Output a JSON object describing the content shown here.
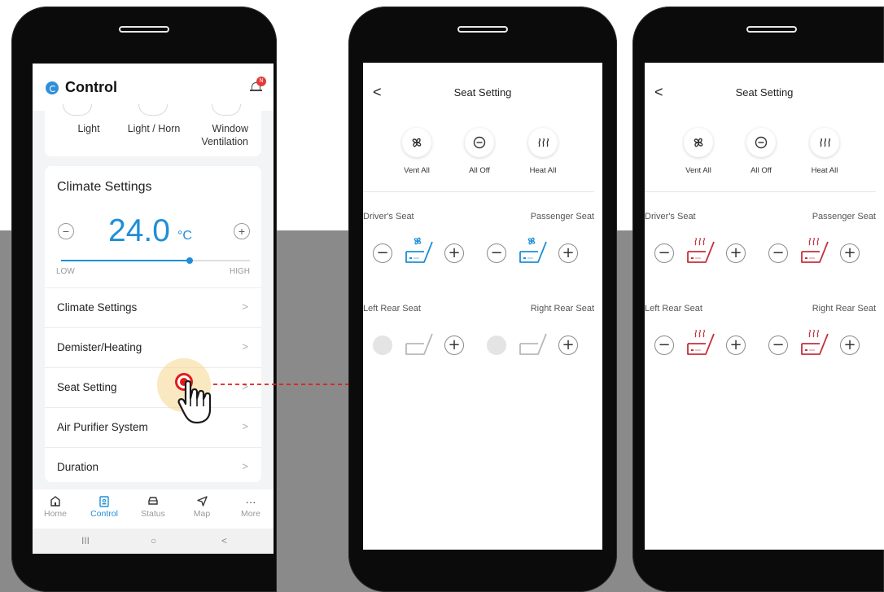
{
  "phone1": {
    "header": {
      "title": "Control",
      "notification_badge": "N"
    },
    "features": [
      "Light",
      "Light / Horn",
      "Window\nVentilation"
    ],
    "climate": {
      "title": "Climate Settings",
      "minus": "−",
      "plus": "+",
      "temperature": "24.0",
      "unit": "°C",
      "slider_level": 0.68,
      "low_label": "LOW",
      "high_label": "HIGH"
    },
    "menu": [
      {
        "label": "Climate Settings",
        "chevron": ">"
      },
      {
        "label": "Demister/Heating",
        "chevron": ">"
      },
      {
        "label": "Seat Setting",
        "chevron": ">"
      },
      {
        "label": "Air Purifier System",
        "chevron": ">"
      },
      {
        "label": "Duration",
        "chevron": ">"
      }
    ],
    "tabs": [
      {
        "label": "Home",
        "icon": "home-icon",
        "active": false
      },
      {
        "label": "Control",
        "icon": "control-icon",
        "active": true
      },
      {
        "label": "Status",
        "icon": "car-icon",
        "active": false
      },
      {
        "label": "Map",
        "icon": "navigation-icon",
        "active": false
      },
      {
        "label": "More",
        "icon": "more-icon",
        "active": false
      }
    ],
    "nav": {
      "recent": "III",
      "home": "○",
      "back": "<"
    }
  },
  "seat_screen_vent": {
    "back": "<",
    "title": "Seat Setting",
    "quick": [
      {
        "label": "Vent All",
        "icon": "fan-icon"
      },
      {
        "label": "All Off",
        "icon": "power-off-icon"
      },
      {
        "label": "Heat All",
        "icon": "heat-icon"
      }
    ],
    "seats": [
      {
        "label": "Driver's Seat",
        "mode": "vent"
      },
      {
        "label": "Passenger Seat",
        "mode": "vent"
      },
      {
        "label": "Left Rear Seat",
        "mode": "off"
      },
      {
        "label": "Right Rear Seat",
        "mode": "off"
      }
    ]
  },
  "seat_screen_heat": {
    "back": "<",
    "title": "Seat Setting",
    "quick": [
      {
        "label": "Vent All",
        "icon": "fan-icon"
      },
      {
        "label": "All Off",
        "icon": "power-off-icon"
      },
      {
        "label": "Heat All",
        "icon": "heat-icon"
      }
    ],
    "seats": [
      {
        "label": "Driver's Seat",
        "mode": "heat"
      },
      {
        "label": "Passenger Seat",
        "mode": "heat"
      },
      {
        "label": "Left Rear Seat",
        "mode": "heat"
      },
      {
        "label": "Right Rear Seat",
        "mode": "heat"
      }
    ]
  },
  "controls": {
    "minus": "−",
    "plus": "+"
  },
  "colors": {
    "accent": "#1e8fd6",
    "heat": "#c4313c",
    "tap": "#e21d1d",
    "background_gray": "#8a8a8a"
  }
}
